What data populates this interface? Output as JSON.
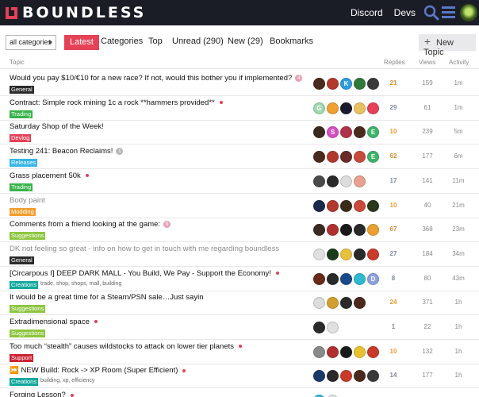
{
  "header": {
    "logo_text": "BOUNDLESS",
    "links": [
      "Discord",
      "Devs"
    ],
    "brand_color": "#e54157"
  },
  "nav": {
    "categories_dropdown": "all categories",
    "tabs": [
      "Latest",
      "Categories",
      "Top",
      "Unread (290)",
      "New (29)",
      "Bookmarks"
    ],
    "new_topic_label": "New Topic"
  },
  "table": {
    "columns": {
      "topic": "Topic",
      "replies": "Replies",
      "views": "Views",
      "activity": "Activity"
    },
    "rows": [
      {
        "title": "Would you pay $10/€10 for a new race? If not, would this bother you if implemented?",
        "badge": "General",
        "badge_color": "#2b2b2b",
        "unread": false,
        "count": "4",
        "count_grey": false,
        "tags": "",
        "replies": "21",
        "reply_color": "#d88b2f",
        "views": "159",
        "activity": "1m",
        "avatars": [
          {
            "c": "#4a2a1c",
            "t": ""
          },
          {
            "c": "#b13a2d",
            "t": ""
          },
          {
            "c": "#2f9be0",
            "t": "K"
          },
          {
            "c": "#2f7a3a",
            "t": ""
          },
          {
            "c": "#3a3a3a",
            "t": ""
          }
        ]
      },
      {
        "title": "Contract: Simple rock mining 1c a rock **hammers provided**",
        "badge": "Trading",
        "badge_color": "#37b34a",
        "unread": true,
        "count": "",
        "count_grey": false,
        "tags": "",
        "replies": "29",
        "reply_color": "#7f8aa0",
        "views": "61",
        "activity": "1m",
        "avatars": [
          {
            "c": "#9ed8b0",
            "t": "G"
          },
          {
            "c": "#f0a030",
            "t": ""
          },
          {
            "c": "#1a1a2e",
            "t": ""
          },
          {
            "c": "#e8c060",
            "t": ""
          },
          {
            "c": "#e54157",
            "t": ""
          }
        ]
      },
      {
        "title": "Saturday Shop of the Week!",
        "badge": "Devlog",
        "badge_color": "#e54157",
        "unread": false,
        "count": "",
        "count_grey": false,
        "tags": "",
        "replies": "10",
        "reply_color": "#e89a2f",
        "views": "239",
        "activity": "5m",
        "avatars": [
          {
            "c": "#3a2b20",
            "t": ""
          },
          {
            "c": "#d44fc0",
            "t": "S"
          },
          {
            "c": "#b0324a",
            "t": ""
          },
          {
            "c": "#4a2a1c",
            "t": ""
          },
          {
            "c": "#3fb36a",
            "t": "E"
          }
        ]
      },
      {
        "title": "Testing 241: Beacon Reclaims!",
        "badge": "Releases",
        "badge_color": "#34b5e5",
        "unread": false,
        "count": "1",
        "count_grey": true,
        "tags": "",
        "replies": "62",
        "reply_color": "#d88b2f",
        "views": "177",
        "activity": "6m",
        "avatars": [
          {
            "c": "#4a2a1c",
            "t": ""
          },
          {
            "c": "#b13a2d",
            "t": ""
          },
          {
            "c": "#6a2a2a",
            "t": ""
          },
          {
            "c": "#c84a3a",
            "t": ""
          },
          {
            "c": "#3fb36a",
            "t": "E"
          }
        ]
      },
      {
        "title": "Grass placement 50k",
        "badge": "Trading",
        "badge_color": "#37b34a",
        "unread": true,
        "count": "",
        "count_grey": false,
        "tags": "",
        "replies": "17",
        "reply_color": "#7f8aa0",
        "views": "141",
        "activity": "11m",
        "avatars": [
          {
            "c": "#4a4a4a",
            "t": ""
          },
          {
            "c": "#2a2a2a",
            "t": ""
          },
          {
            "c": "#dcdcdc",
            "t": ""
          },
          {
            "c": "#e8a090",
            "t": ""
          }
        ]
      },
      {
        "title": "Body paint",
        "badge": "Modding",
        "badge_color": "#f29e2e",
        "unread": false,
        "read": true,
        "count": "",
        "count_grey": false,
        "tags": "",
        "replies": "10",
        "reply_color": "#e89a2f",
        "views": "40",
        "activity": "21m",
        "avatars": [
          {
            "c": "#1a2a4a",
            "t": ""
          },
          {
            "c": "#b13a2d",
            "t": ""
          },
          {
            "c": "#3a2a1a",
            "t": ""
          },
          {
            "c": "#c84a3a",
            "t": ""
          },
          {
            "c": "#2a3a1a",
            "t": ""
          }
        ]
      },
      {
        "title": "Comments from a friend looking at the game:",
        "badge": "Suggestions",
        "badge_color": "#8dc63f",
        "unread": false,
        "count": "9",
        "count_grey": false,
        "tags": "",
        "replies": "67",
        "reply_color": "#d88b2f",
        "views": "368",
        "activity": "23m",
        "avatars": [
          {
            "c": "#3a2b20",
            "t": ""
          },
          {
            "c": "#b03030",
            "t": ""
          },
          {
            "c": "#1a1a1a",
            "t": ""
          },
          {
            "c": "#2a2a2a",
            "t": ""
          },
          {
            "c": "#e8a030",
            "t": ""
          }
        ]
      },
      {
        "title": "DK not feeling so great - info on how to get in touch with me regarding boundless",
        "badge": "General",
        "badge_color": "#2b2b2b",
        "unread": false,
        "read": true,
        "count": "",
        "count_grey": false,
        "tags": "",
        "replies": "27",
        "reply_color": "#7f8aa0",
        "views": "184",
        "activity": "34m",
        "avatars": [
          {
            "c": "#e0e0e0",
            "t": ""
          },
          {
            "c": "#1a3a1a",
            "t": ""
          },
          {
            "c": "#e8c040",
            "t": ""
          },
          {
            "c": "#2a2a2a",
            "t": ""
          },
          {
            "c": "#c83a2a",
            "t": ""
          }
        ]
      },
      {
        "title": "[Circarpous I] DEEP DARK MALL - You Build, We Pay - Support the Economy!",
        "badge": "Creations",
        "badge_color": "#12a89d",
        "unread": true,
        "count": "",
        "count_grey": false,
        "tags": "trade, shop, shops, mall, building",
        "replies": "8",
        "reply_color": "#7f8aa0",
        "views": "80",
        "activity": "43m",
        "avatars": [
          {
            "c": "#6a2a1a",
            "t": ""
          },
          {
            "c": "#2a2a2a",
            "t": ""
          },
          {
            "c": "#1a4a8a",
            "t": ""
          },
          {
            "c": "#30b8d0",
            "t": ""
          },
          {
            "c": "#8aa0e0",
            "t": "D"
          }
        ]
      },
      {
        "title": "It would be a great time for a Steam/PSN sale…Just sayin",
        "badge": "Suggestions",
        "badge_color": "#8dc63f",
        "unread": false,
        "count": "",
        "count_grey": false,
        "tags": "",
        "replies": "24",
        "reply_color": "#e89a2f",
        "views": "371",
        "activity": "1h",
        "avatars": [
          {
            "c": "#dcdcdc",
            "t": ""
          },
          {
            "c": "#d0a030",
            "t": ""
          },
          {
            "c": "#2a2a2a",
            "t": ""
          },
          {
            "c": "#4a2a1c",
            "t": ""
          }
        ]
      },
      {
        "title": "Extradimensional space",
        "badge": "Suggestions",
        "badge_color": "#8dc63f",
        "unread": true,
        "count": "",
        "count_grey": false,
        "tags": "",
        "replies": "1",
        "reply_color": "#7f8aa0",
        "views": "22",
        "activity": "1h",
        "avatars": [
          {
            "c": "#2a2a2a",
            "t": ""
          },
          {
            "c": "#e0e0e0",
            "t": ""
          }
        ]
      },
      {
        "title": "Too much “stealth” causes wildstocks to attack on lower tier planets",
        "badge": "Support",
        "badge_color": "#cc2232",
        "unread": true,
        "count": "",
        "count_grey": false,
        "tags": "",
        "replies": "10",
        "reply_color": "#e89a2f",
        "views": "132",
        "activity": "1h",
        "avatars": [
          {
            "c": "#8a8a8a",
            "t": ""
          },
          {
            "c": "#b03030",
            "t": ""
          },
          {
            "c": "#1a1a1a",
            "t": ""
          },
          {
            "c": "#e8c030",
            "t": ""
          },
          {
            "c": "#c83a2a",
            "t": ""
          }
        ]
      },
      {
        "title": "⏩ NEW Build: Rock -> XP Room (Super Efficient)",
        "badge": "Creations",
        "badge_color": "#12a89d",
        "unread": true,
        "count": "",
        "count_grey": false,
        "tags": "building, xp, efficiency",
        "replies": "14",
        "reply_color": "#7f8aa0",
        "views": "177",
        "activity": "1h",
        "avatars": [
          {
            "c": "#1a3a6a",
            "t": ""
          },
          {
            "c": "#2a2a2a",
            "t": ""
          },
          {
            "c": "#c83a2a",
            "t": ""
          },
          {
            "c": "#4a2a1c",
            "t": ""
          },
          {
            "c": "#3a3a3a",
            "t": ""
          }
        ]
      },
      {
        "title": "Forging Lesson?",
        "badge": "",
        "badge_color": "#8dc63f",
        "unread": true,
        "count": "",
        "count_grey": false,
        "tags": "",
        "replies": "",
        "reply_color": "#7f8aa0",
        "views": "",
        "activity": "",
        "avatars": [
          {
            "c": "#30b8d0",
            "t": ""
          },
          {
            "c": "#e0e0e0",
            "t": ""
          }
        ]
      }
    ]
  }
}
